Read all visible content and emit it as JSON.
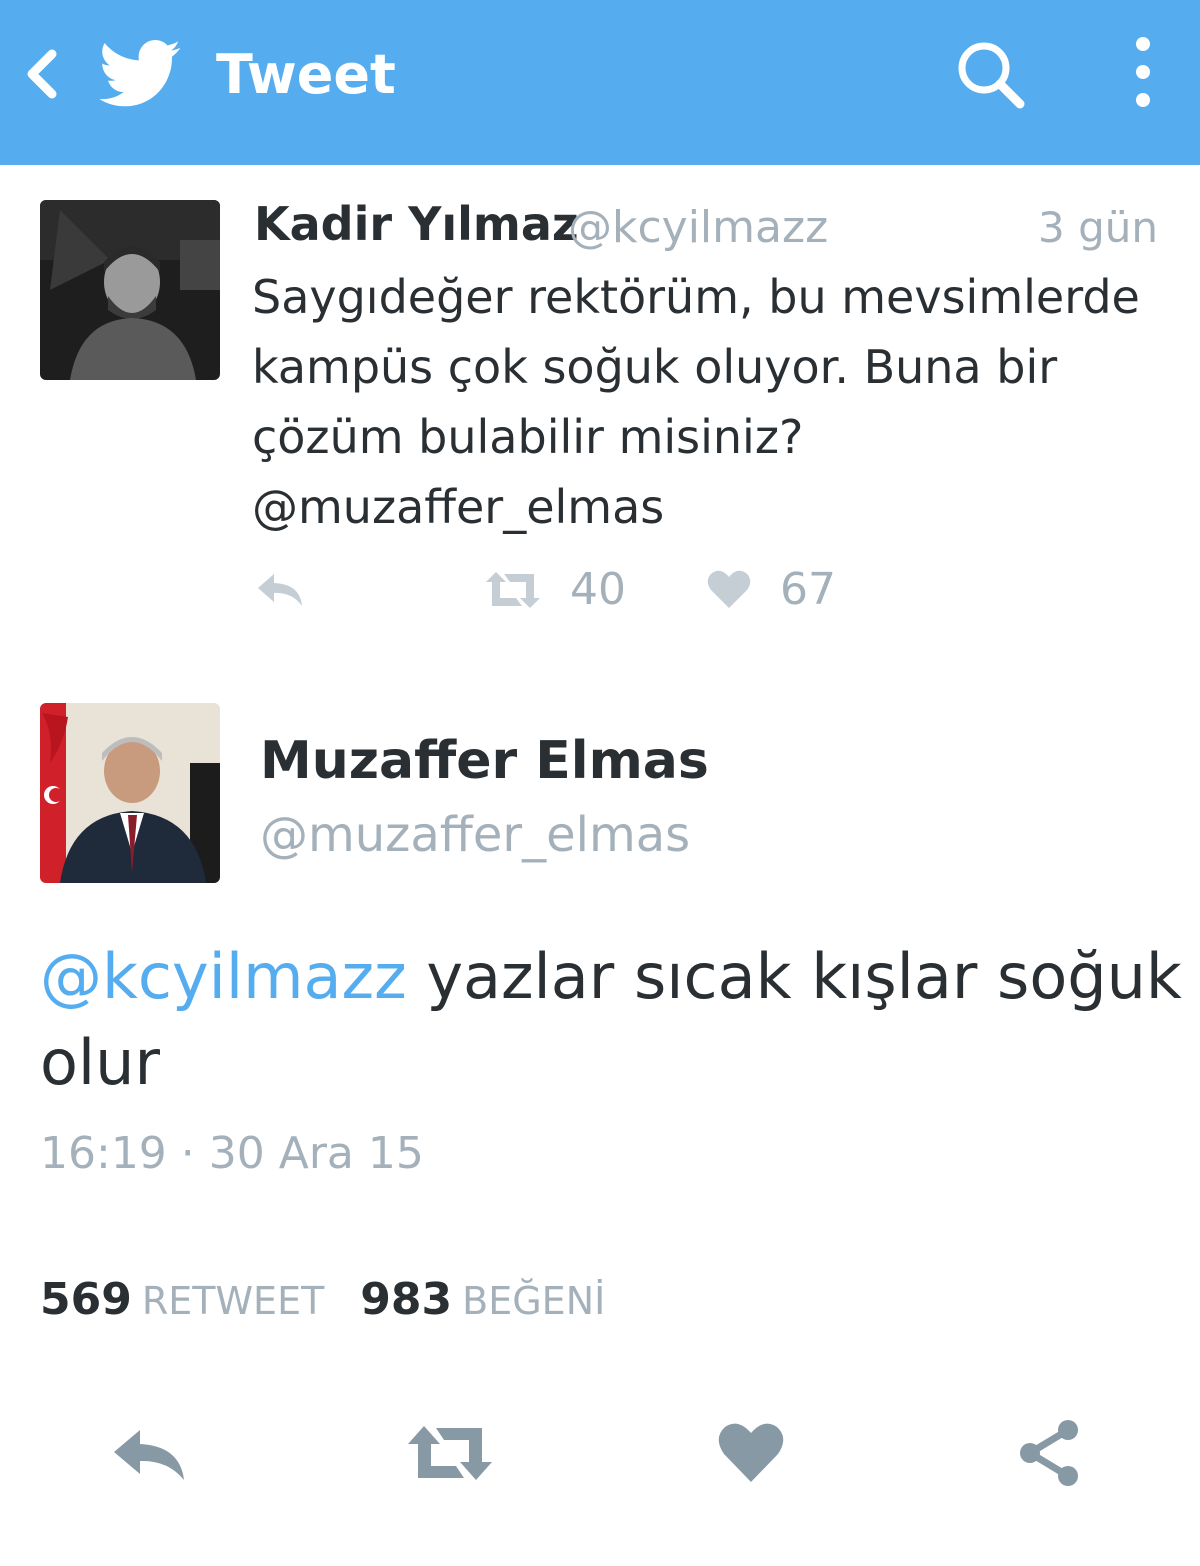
{
  "appbar": {
    "title": "Tweet",
    "back_icon": "back-chevron-icon",
    "logo_icon": "twitter-bird-icon",
    "search_icon": "search-icon",
    "menu_icon": "more-vertical-icon",
    "color": "#55acee"
  },
  "quoted_tweet": {
    "name": "Kadir Yılmaz",
    "handle": "@kcyilmazz",
    "time": "3 gün",
    "text_lines": [
      "Saygıdeğer rektörüm, bu mevsimlerde",
      "kampüs çok soğuk oluyor. Buna bir",
      "çözüm bulabilir misiniz?",
      "@muzaffer_elmas"
    ],
    "retweet_count": "40",
    "like_count": "67"
  },
  "main_tweet": {
    "name": "Muzaffer Elmas",
    "handle": "@muzaffer_elmas",
    "mention": "@kcyilmazz",
    "text_line1": " yazlar sıcak kışlar soğuk",
    "text_line2": "olur",
    "timestamp": "16:19 · 30 Ara 15",
    "retweets": "569",
    "retweets_label": "RETWEET",
    "likes": "983",
    "likes_label": "BEĞENİ"
  },
  "colors": {
    "accent": "#55acee",
    "text": "#292f33",
    "muted": "#a4b1ba",
    "icon_gray": "#8899a6"
  }
}
